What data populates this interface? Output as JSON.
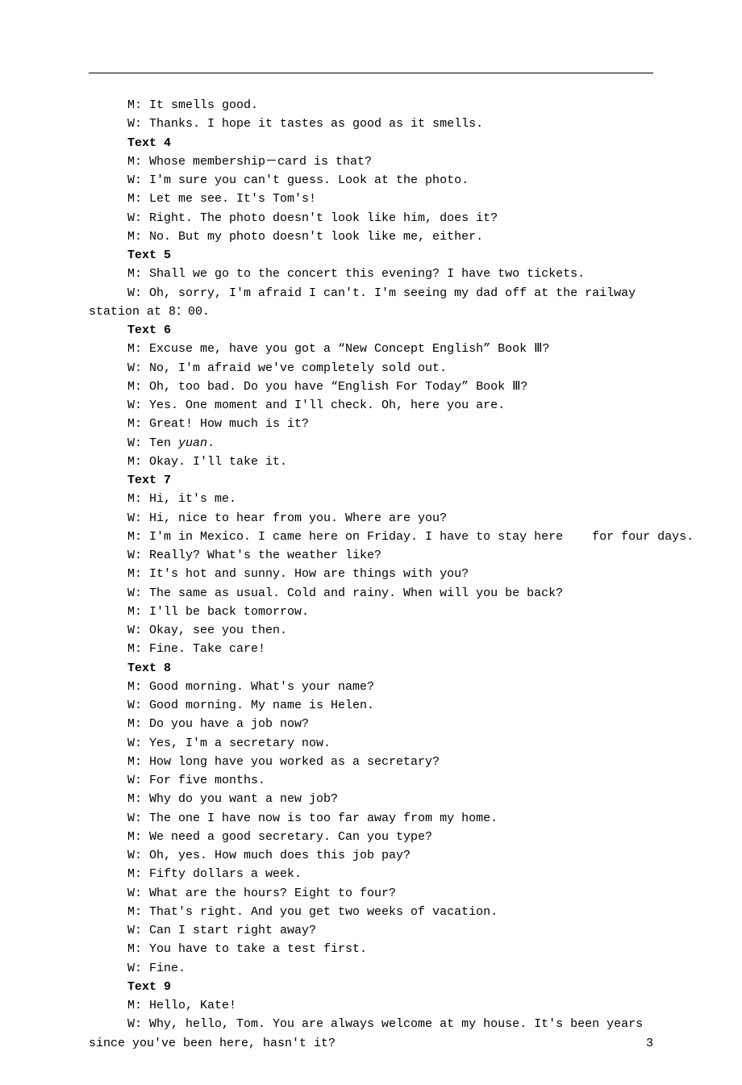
{
  "page_number": "3",
  "texts": [
    {
      "heading": null,
      "lines": [
        {
          "cls": "indent",
          "t": "M: It smells good."
        },
        {
          "cls": "indent",
          "t": "W: Thanks. I hope it tastes as good as it smells."
        }
      ]
    },
    {
      "heading": "Text 4",
      "lines": [
        {
          "cls": "indent",
          "t": "M: Whose membership－card is that?"
        },
        {
          "cls": "indent",
          "t": "W: I'm sure you can't guess. Look at the photo."
        },
        {
          "cls": "indent",
          "t": "M: Let me see. It's Tom's!"
        },
        {
          "cls": "indent",
          "t": "W: Right. The photo doesn't look like him, does it?"
        },
        {
          "cls": "indent",
          "t": "M: No. But my photo doesn't look like me, either."
        }
      ]
    },
    {
      "heading": "Text 5",
      "lines": [
        {
          "cls": "indent",
          "t": "M: Shall we go to the concert this evening? I have two tickets."
        },
        {
          "cls": "hang",
          "t": "    W: Oh, sorry, I'm afraid I can't. I'm seeing my dad off at the    railway station at 8：00."
        }
      ]
    },
    {
      "heading": "Text 6",
      "lines": [
        {
          "cls": "indent",
          "t": "M: Excuse me, have you got a “New Concept English” Book Ⅲ?"
        },
        {
          "cls": "indent",
          "t": "W: No, I'm afraid we've completely sold out."
        },
        {
          "cls": "indent",
          "t": "M: Oh, too bad. Do you have “English For Today” Book Ⅲ?"
        },
        {
          "cls": "indent",
          "t": "W: Yes. One moment and I'll check. Oh, here you are."
        },
        {
          "cls": "indent",
          "t": "M: Great! How much is it?"
        },
        {
          "cls": "indent",
          "t": "W: Ten <i>yuan</i>."
        },
        {
          "cls": "indent",
          "t": "M: Okay. I'll take it."
        }
      ]
    },
    {
      "heading": "Text 7",
      "lines": [
        {
          "cls": "indent",
          "t": "M: Hi, it's me."
        },
        {
          "cls": "indent",
          "t": "W: Hi, nice to hear from you. Where are you?"
        },
        {
          "cls": "indent",
          "t": "M: I'm in Mexico. I came here on Friday. I have to stay here    for four days."
        },
        {
          "cls": "indent",
          "t": "W: Really? What's the weather like?"
        },
        {
          "cls": "indent",
          "t": "M: It's hot and sunny. How are things with you?"
        },
        {
          "cls": "indent",
          "t": "W: The same as usual. Cold and rainy. When will you be back?"
        },
        {
          "cls": "indent",
          "t": "M: I'll be back tomorrow."
        },
        {
          "cls": "indent",
          "t": "W: Okay, see you then."
        },
        {
          "cls": "indent",
          "t": "M: Fine. Take care!"
        }
      ]
    },
    {
      "heading": "Text 8",
      "lines": [
        {
          "cls": "indent",
          "t": "M: Good morning. What's your name?"
        },
        {
          "cls": "indent",
          "t": "W: Good morning. My name is Helen."
        },
        {
          "cls": "indent",
          "t": "M: Do you have a job now?"
        },
        {
          "cls": "indent",
          "t": "W: Yes, I'm a secretary now."
        },
        {
          "cls": "indent",
          "t": "M: How long have you worked as a secretary?"
        },
        {
          "cls": "indent",
          "t": "W: For five months."
        },
        {
          "cls": "indent",
          "t": "M: Why do you want a new job?"
        },
        {
          "cls": "indent",
          "t": "W: The one I have now is too far away from my home."
        },
        {
          "cls": "indent",
          "t": "M: We need a good secretary. Can you type?"
        },
        {
          "cls": "indent",
          "t": "W: Oh, yes. How much does this job pay?"
        },
        {
          "cls": "indent",
          "t": "M: Fifty dollars a week."
        },
        {
          "cls": "indent",
          "t": "W: What are the hours? Eight to four?"
        },
        {
          "cls": "indent",
          "t": "M: That's right. And you get two weeks of vacation."
        },
        {
          "cls": "indent",
          "t": "W: Can I start right away?"
        },
        {
          "cls": "indent",
          "t": "M: You have to take a test first."
        },
        {
          "cls": "indent",
          "t": "W: Fine."
        }
      ]
    },
    {
      "heading": "Text 9",
      "lines": [
        {
          "cls": "indent",
          "t": "M: Hello, Kate!"
        },
        {
          "cls": "hang",
          "t": "    W: Why, hello, Tom. You are always welcome at my house. It's    been years since you've been here, hasn't it?"
        }
      ]
    }
  ]
}
